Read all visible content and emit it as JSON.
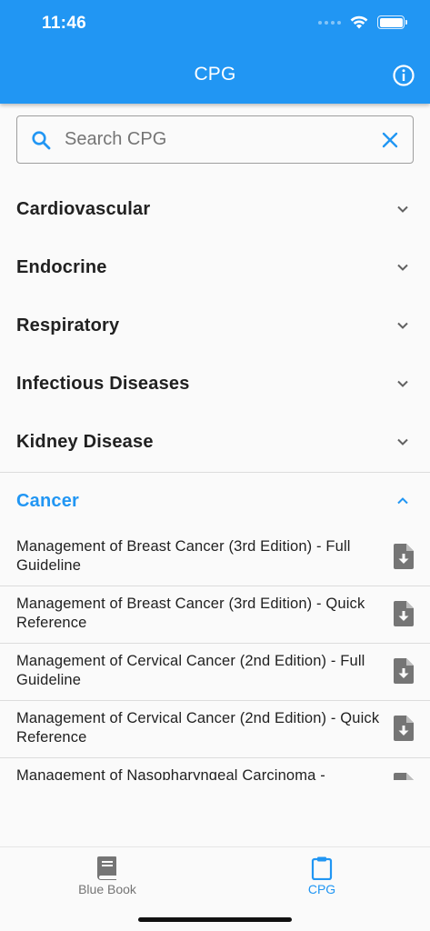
{
  "status_bar": {
    "time": "11:46"
  },
  "header": {
    "title": "CPG"
  },
  "search": {
    "placeholder": "Search CPG",
    "value": ""
  },
  "categories": [
    {
      "label": "Cardiovascular",
      "expanded": false
    },
    {
      "label": "Endocrine",
      "expanded": false
    },
    {
      "label": "Respiratory",
      "expanded": false
    },
    {
      "label": "Infectious Diseases",
      "expanded": false
    },
    {
      "label": "Kidney Disease",
      "expanded": false
    },
    {
      "label": "Cancer",
      "expanded": true
    }
  ],
  "cancer_guidelines": [
    {
      "title": "Management of Breast Cancer (3rd Edition) - Full Guideline"
    },
    {
      "title": "Management of Breast Cancer (3rd Edition) - Quick Reference"
    },
    {
      "title": "Management of Cervical Cancer (2nd Edition) - Full Guideline"
    },
    {
      "title": "Management of Cervical Cancer (2nd Edition) - Quick Reference"
    },
    {
      "title": "Management of Nasopharyngeal Carcinoma -"
    }
  ],
  "bottom_nav": {
    "items": [
      {
        "label": "Blue Book",
        "icon": "book-icon",
        "active": false
      },
      {
        "label": "CPG",
        "icon": "clipboard-icon",
        "active": true
      }
    ]
  },
  "colors": {
    "primary": "#2196f3",
    "text": "#212121",
    "icon_grey": "#757575",
    "background": "#fafafa"
  }
}
